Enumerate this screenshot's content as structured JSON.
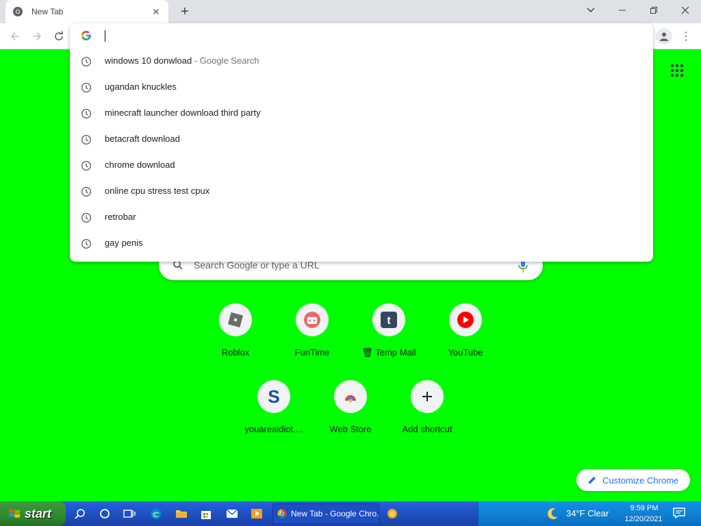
{
  "browser": {
    "tab_title": "New Tab",
    "tab_close_glyph": "✕",
    "new_tab_glyph": "+",
    "window_controls": [
      "tabsearch",
      "minimize",
      "restore",
      "close"
    ],
    "menu_glyph": "⋮"
  },
  "omnibox": {
    "value": "",
    "suggestions": [
      {
        "text": "windows 10 donwload",
        "suffix": " - Google Search"
      },
      {
        "text": "ugandan knuckles",
        "suffix": ""
      },
      {
        "text": "minecraft launcher download third party",
        "suffix": ""
      },
      {
        "text": "betacraft download",
        "suffix": ""
      },
      {
        "text": "chrome download",
        "suffix": ""
      },
      {
        "text": "online cpu stress test cpux",
        "suffix": ""
      },
      {
        "text": "retrobar",
        "suffix": ""
      },
      {
        "text": "gay penis",
        "suffix": ""
      }
    ]
  },
  "ntp": {
    "background_color": "#00ff00",
    "search_placeholder": "Search Google or type a URL",
    "shortcuts": [
      {
        "label": "Roblox",
        "icon": "roblox-icon"
      },
      {
        "label": "FunTime",
        "icon": "funtime-icon"
      },
      {
        "label": "Temp Mail",
        "icon": "tempmail-icon",
        "prefix_glyph": "🗑"
      },
      {
        "label": "YouTube",
        "icon": "youtube-icon"
      },
      {
        "label": "youareaidiot....",
        "icon": "s-icon"
      },
      {
        "label": "Web Store",
        "icon": "webstore-icon"
      },
      {
        "label": "Add shortcut",
        "icon": "plus-icon"
      }
    ],
    "customize_label": "Customize Chrome"
  },
  "taskbar": {
    "start_label": "start",
    "active_task": "New Tab - Google Chro...",
    "weather": "34°F  Clear",
    "time": "9:59 PM",
    "date": "12/20/2021"
  }
}
